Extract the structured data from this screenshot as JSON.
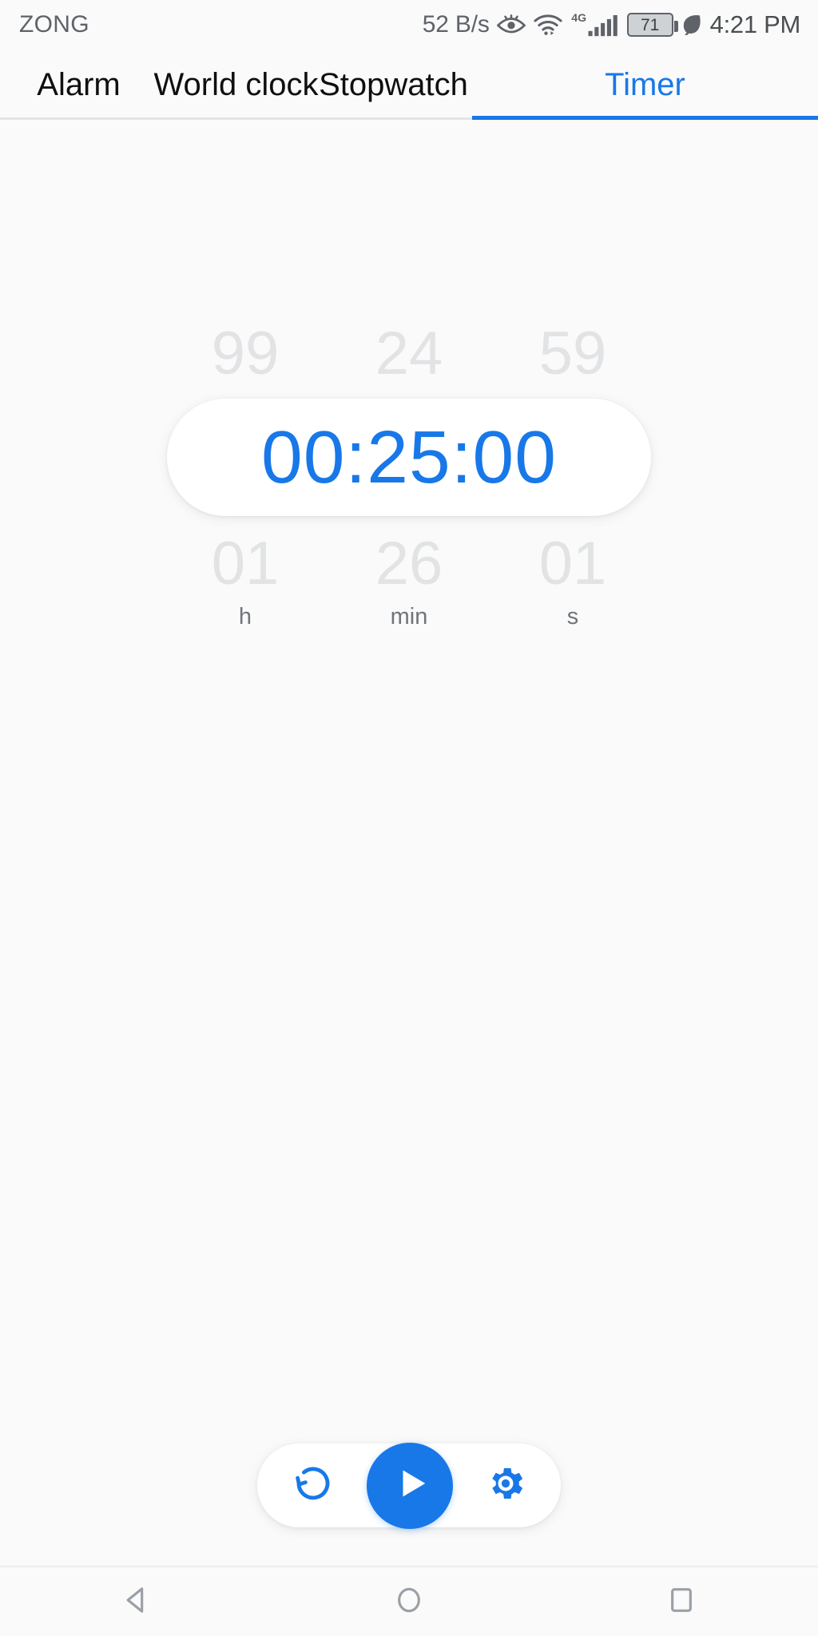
{
  "status_bar": {
    "carrier": "ZONG",
    "network_speed": "52 B/s",
    "icons": [
      "eye-comfort-icon",
      "wifi-icon",
      "signal-4g-icon",
      "battery-icon",
      "power-saving-leaf-icon"
    ],
    "network_type": "4G",
    "battery_percent": "71",
    "time": "4:21 PM"
  },
  "tabs": [
    {
      "label": "Alarm",
      "active": false
    },
    {
      "label": "World clock",
      "active": false
    },
    {
      "label": "Stopwatch",
      "active": false
    },
    {
      "label": "Timer",
      "active": true
    }
  ],
  "timer": {
    "ghost_above": {
      "hours": "99",
      "minutes": "24",
      "seconds": "59"
    },
    "selected": "00:25:00",
    "ghost_below": {
      "hours": "01",
      "minutes": "26",
      "seconds": "01"
    },
    "units": {
      "hours": "h",
      "minutes": "min",
      "seconds": "s"
    }
  },
  "controls": {
    "reset_label": "reset-icon",
    "play_label": "play-icon",
    "settings_label": "settings-gear-icon"
  },
  "nav_bar": {
    "back": "back-icon",
    "home": "home-icon",
    "recents": "recents-icon"
  },
  "colors": {
    "accent": "#1878e8",
    "background": "#fafafa",
    "ghost_text": "#e2e3e5",
    "unit_text": "#70757a",
    "status_text": "#5f6368"
  }
}
